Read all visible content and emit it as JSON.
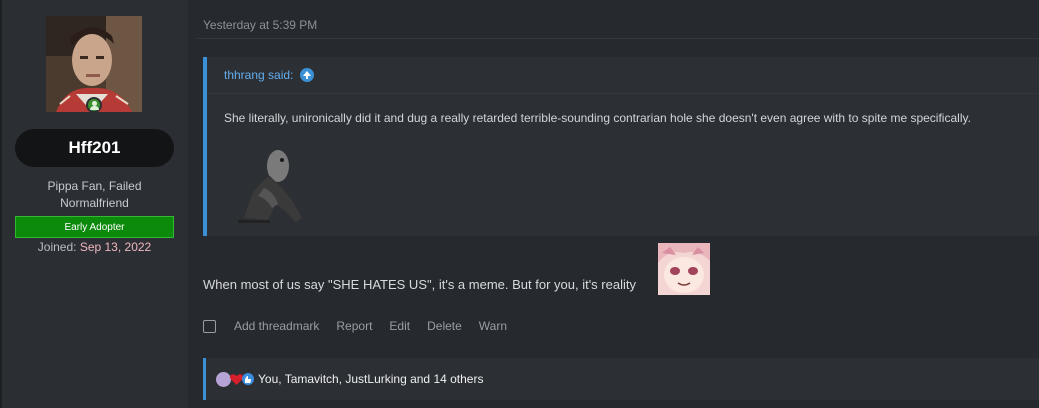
{
  "user": {
    "name": "Hff201",
    "title": "Pippa Fan, Failed Normalfriend",
    "banner": "Early Adopter",
    "joined_label": "Joined:",
    "joined_date": "Sep 13, 2022",
    "online": true
  },
  "post": {
    "timestamp": "Yesterday at 5:39 PM",
    "quote": {
      "author": "thhrang said:",
      "text": "She literally, unironically did it and dug a really retarded terrible-sounding contrarian hole she doesn't even agree with to spite me specifically."
    },
    "body": "When most of us say \"SHE HATES US\", it's a meme. But for you, it's reality",
    "actions": [
      "Add threadmark",
      "Report",
      "Edit",
      "Delete",
      "Warn"
    ],
    "reactions": {
      "text": "You, Tamavitch, JustLurking and 14 others",
      "icons": [
        "anime-face-icon",
        "heart-icon",
        "like-icon"
      ]
    }
  },
  "colors": {
    "accent": "#3b91d6",
    "banner_green": "#0c8a0c",
    "joined_date": "#f0b6c0",
    "online": "#3b8f2f"
  }
}
